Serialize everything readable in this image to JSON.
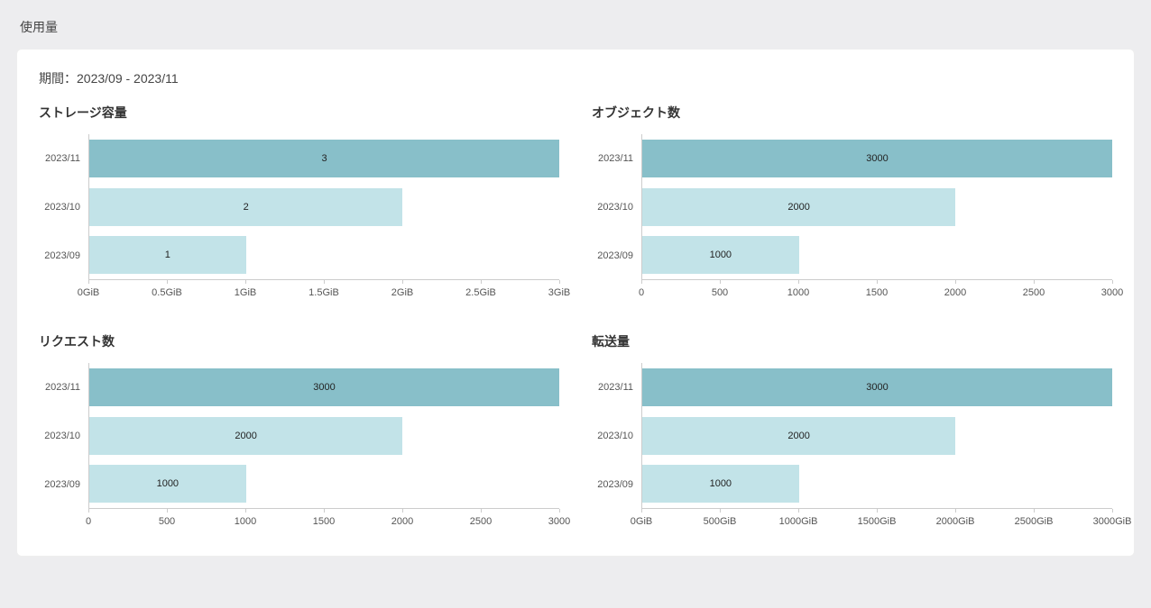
{
  "page_title": "使用量",
  "period_label": "期間：2023/09 - 2023/11",
  "colors": {
    "bar_shades": [
      "#88bfc9",
      "#c2e3e8",
      "#c2e3e8"
    ]
  },
  "chart_data": [
    {
      "id": "storage",
      "type": "bar",
      "orientation": "horizontal",
      "title": "ストレージ容量",
      "categories": [
        "2023/11",
        "2023/10",
        "2023/09"
      ],
      "values": [
        3,
        2,
        1
      ],
      "xlim": [
        0,
        3
      ],
      "x_ticks": [
        0,
        0.5,
        1,
        1.5,
        2,
        2.5,
        3
      ],
      "x_tick_labels": [
        "0GiB",
        "0.5GiB",
        "1GiB",
        "1.5GiB",
        "2GiB",
        "2.5GiB",
        "3GiB"
      ]
    },
    {
      "id": "objects",
      "type": "bar",
      "orientation": "horizontal",
      "title": "オブジェクト数",
      "categories": [
        "2023/11",
        "2023/10",
        "2023/09"
      ],
      "values": [
        3000,
        2000,
        1000
      ],
      "xlim": [
        0,
        3000
      ],
      "x_ticks": [
        0,
        500,
        1000,
        1500,
        2000,
        2500,
        3000
      ],
      "x_tick_labels": [
        "0",
        "500",
        "1000",
        "1500",
        "2000",
        "2500",
        "3000"
      ]
    },
    {
      "id": "requests",
      "type": "bar",
      "orientation": "horizontal",
      "title": "リクエスト数",
      "categories": [
        "2023/11",
        "2023/10",
        "2023/09"
      ],
      "values": [
        3000,
        2000,
        1000
      ],
      "xlim": [
        0,
        3000
      ],
      "x_ticks": [
        0,
        500,
        1000,
        1500,
        2000,
        2500,
        3000
      ],
      "x_tick_labels": [
        "0",
        "500",
        "1000",
        "1500",
        "2000",
        "2500",
        "3000"
      ]
    },
    {
      "id": "transfer",
      "type": "bar",
      "orientation": "horizontal",
      "title": "転送量",
      "categories": [
        "2023/11",
        "2023/10",
        "2023/09"
      ],
      "values": [
        3000,
        2000,
        1000
      ],
      "xlim": [
        0,
        3000
      ],
      "x_ticks": [
        0,
        500,
        1000,
        1500,
        2000,
        2500,
        3000
      ],
      "x_tick_labels": [
        "0GiB",
        "500GiB",
        "1000GiB",
        "1500GiB",
        "2000GiB",
        "2500GiB",
        "3000GiB"
      ]
    }
  ]
}
